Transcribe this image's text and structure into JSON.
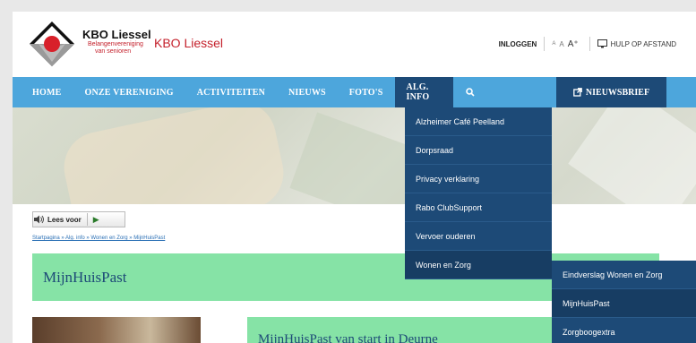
{
  "header": {
    "brand_name": "KBO Liessel",
    "brand_sub1": "Belangenvereniging",
    "brand_sub2": "van senioren",
    "site_title": "KBO Liessel",
    "login_label": "INLOGGEN",
    "font_small": "A",
    "font_medium": "A",
    "font_large": "A⁺",
    "help_label": "HULP OP AFSTAND"
  },
  "nav": {
    "items": [
      {
        "label": "HOME"
      },
      {
        "label": "ONZE VERENIGING"
      },
      {
        "label": "ACTIVITEITEN"
      },
      {
        "label": "NIEUWS"
      },
      {
        "label": "FOTO'S"
      },
      {
        "label": "ALG. INFO"
      }
    ],
    "newsletter_label": "NIEUWSBRIEF"
  },
  "dropdown": {
    "items": [
      {
        "label": "Alzheimer Café Peelland"
      },
      {
        "label": "Dorpsraad"
      },
      {
        "label": "Privacy verklaring"
      },
      {
        "label": "Rabo ClubSupport"
      },
      {
        "label": "Vervoer ouderen"
      },
      {
        "label": "Wonen en Zorg"
      }
    ]
  },
  "submenu": {
    "items": [
      {
        "label": "Eindverslag Wonen en Zorg"
      },
      {
        "label": "MijnHuisPast"
      },
      {
        "label": "Zorgboogextra"
      }
    ]
  },
  "content": {
    "lees_voor_label": "Lees voor",
    "breadcrumb": "Startpagina » Alg. info » Wonen en Zorg » MijnHuisPast",
    "page_title": "MijnHuisPast",
    "article_title": "MijnHuisPast van start in Deurne"
  },
  "colors": {
    "nav_bg": "#4da6dc",
    "nav_active": "#1d4a77",
    "accent_green": "#86e3a6",
    "brand_red": "#c4202b"
  }
}
